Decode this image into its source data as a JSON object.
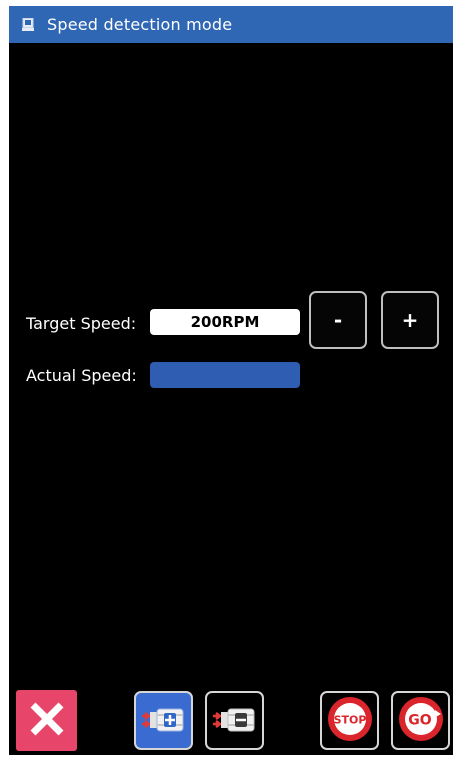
{
  "window": {
    "title": "Speed detection mode",
    "title_icon": "device-icon"
  },
  "form": {
    "target_label": "Target Speed:",
    "target_value": "200RPM",
    "actual_label": "Actual Speed:",
    "actual_value": ""
  },
  "controls": {
    "decrease_label": "-",
    "increase_label": "+"
  },
  "toolbar": {
    "close_icon": "close-icon",
    "speed_up_icon": "motor-speed-up-icon",
    "speed_down_icon": "motor-speed-down-icon",
    "stop_label": "STOP",
    "go_label": "GO"
  },
  "colors": {
    "title_bar": "#2f67b5",
    "background": "#000000",
    "actual_field": "#2f5db1",
    "close_button": "#e8456a",
    "speed_up_button": "#3a6bd0",
    "sign_red": "#d9252b"
  }
}
